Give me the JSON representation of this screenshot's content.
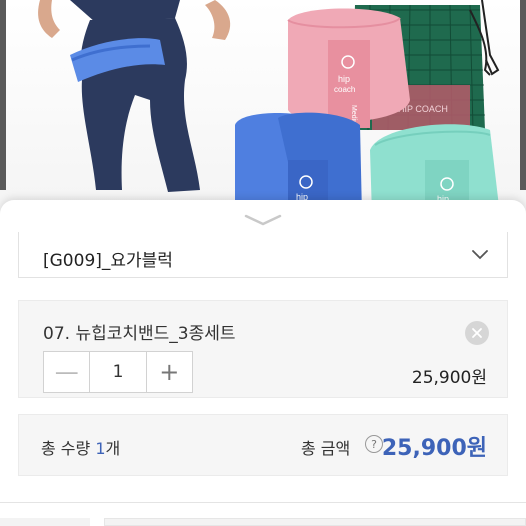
{
  "product_image": {
    "band_brand_text": [
      "hip",
      "coach"
    ],
    "band_size_text": "Medium",
    "bag_text": "HIP COACH",
    "colors": {
      "pink": "#f0a9b6",
      "blue": "#4f7fe0",
      "mint": "#8fe0cf",
      "legging": "#2c3a5e",
      "bag": "#2f8f6a"
    }
  },
  "option": {
    "selected_label": "[G009]_요가블럭"
  },
  "selected_item": {
    "name": "07. 뉴힙코치밴드_3종세트",
    "quantity": "1",
    "minus_label": "—",
    "plus_label": "+",
    "price": "25,900원"
  },
  "summary": {
    "qty_prefix": "총 수량 ",
    "qty_value": "1",
    "qty_suffix": "개",
    "amount_label": "총 금액",
    "help_label": "?",
    "amount_value": "25,900원"
  },
  "accent_color": "#3d63b8"
}
